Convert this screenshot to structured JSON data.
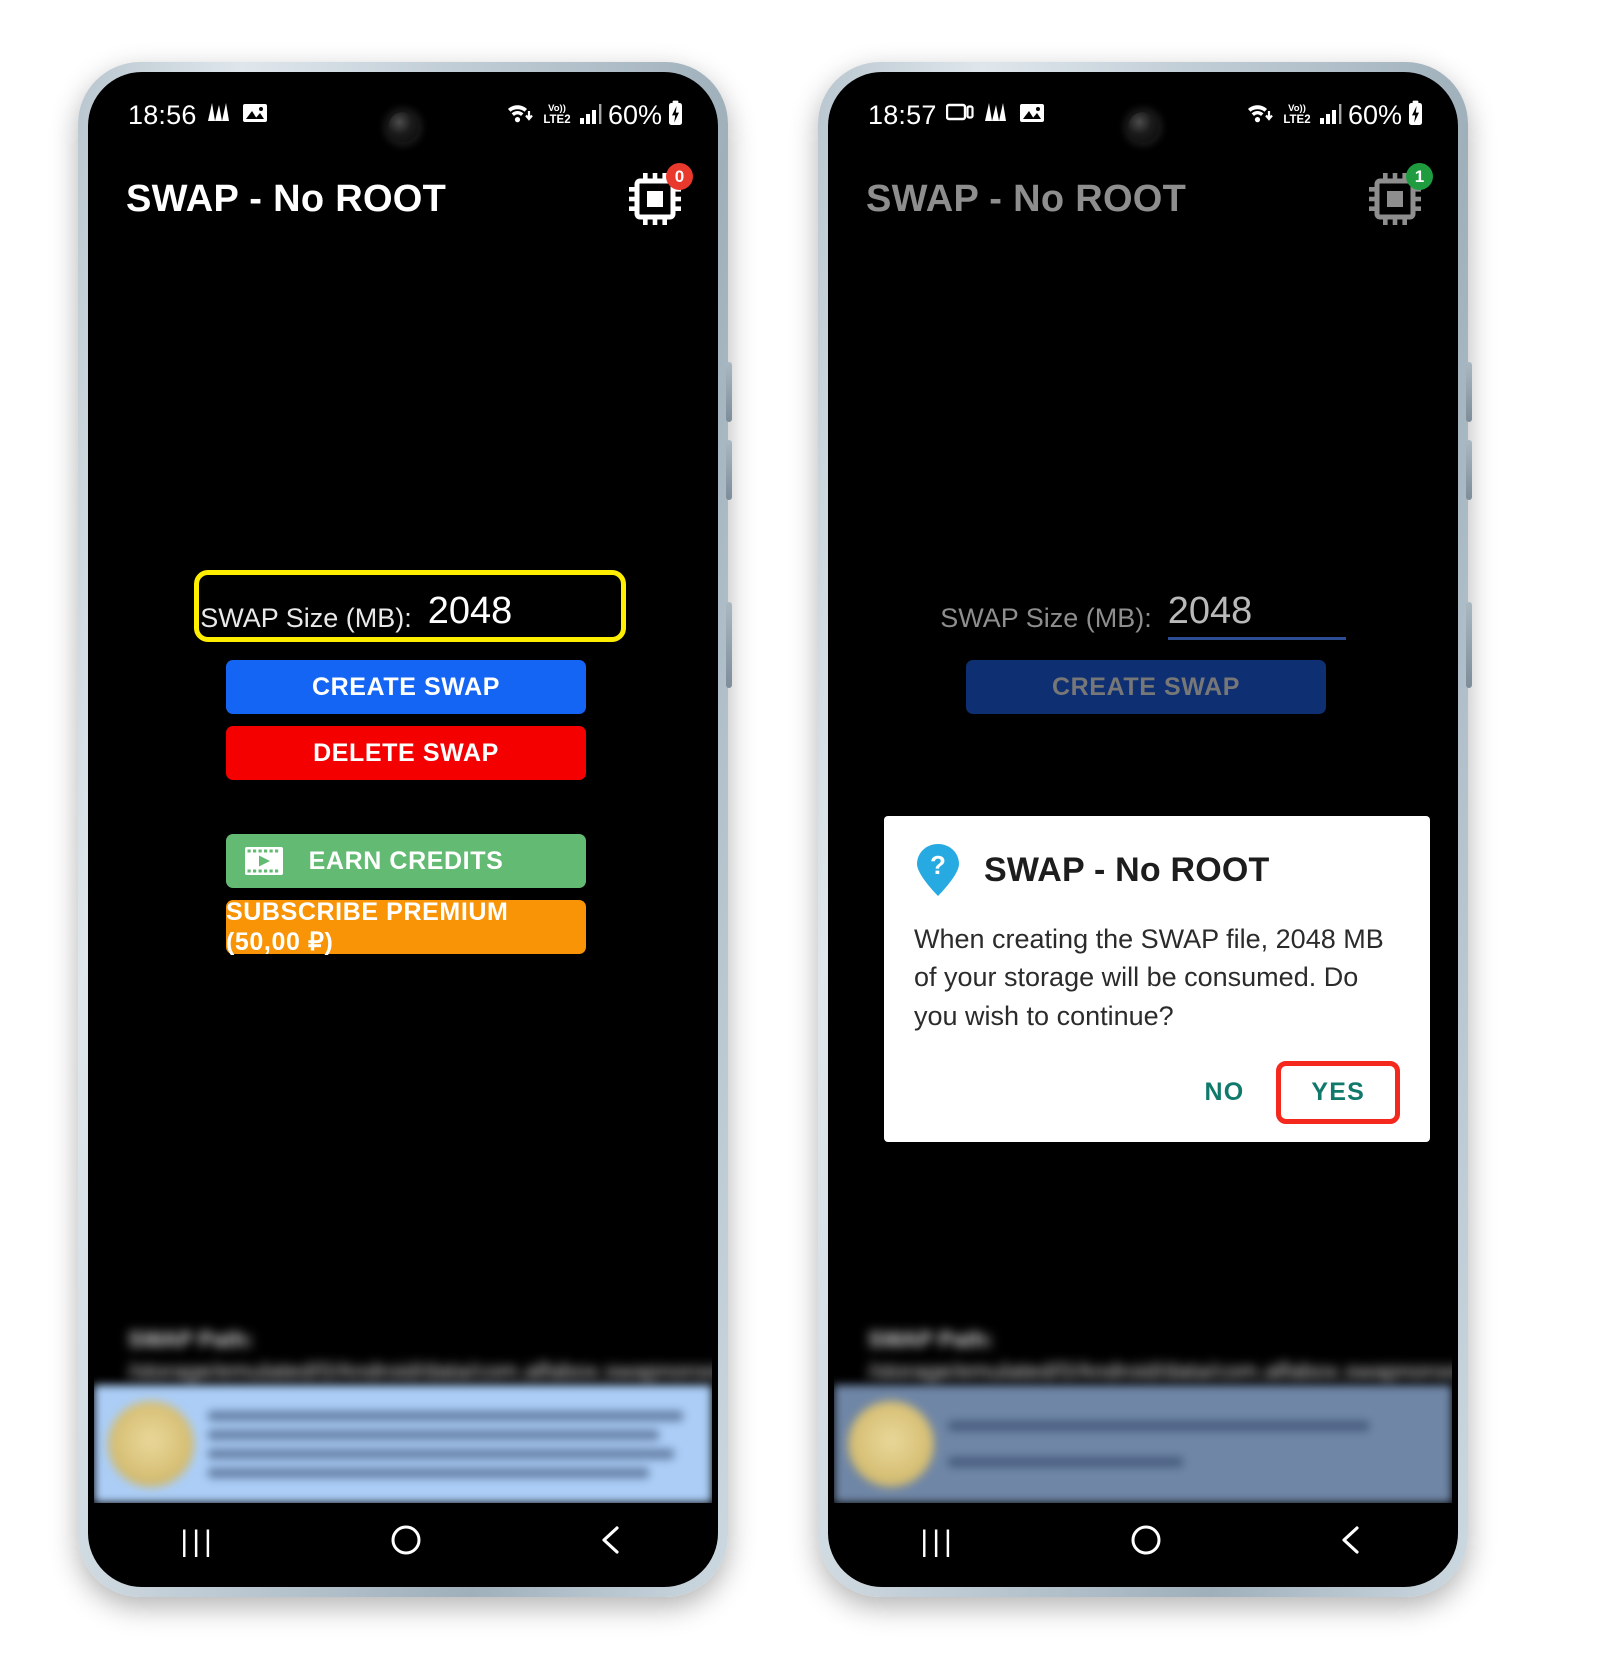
{
  "app": {
    "title": "SWAP - No ROOT",
    "cpu_icon": "cpu-chip-icon"
  },
  "colors": {
    "create": "#1565f5",
    "delete": "#f40000",
    "earn": "#63ba73",
    "premium": "#f89406",
    "highlight_yellow": "#ffee00",
    "highlight_red": "#f5281e",
    "dialog_action": "#11796b",
    "input_underline": "#3f6fd8"
  },
  "phones": [
    {
      "id": "phone-left",
      "status_bar": {
        "time": "18:56",
        "left_icons": [
          "music-waveform-icon",
          "image-icon"
        ],
        "right_icons": [
          "wifi-icon",
          "volte-lte2-icon",
          "signal-bars-icon"
        ],
        "battery": "60%",
        "battery_icon": "battery-charging-icon"
      },
      "badge": {
        "count": "0",
        "color": "#e8392c"
      },
      "form": {
        "size_label": "SWAP Size (MB):",
        "size_value": "2048"
      },
      "buttons": [
        {
          "name": "create-swap-button",
          "label": "CREATE SWAP"
        },
        {
          "name": "delete-swap-button",
          "label": "DELETE SWAP"
        },
        {
          "name": "earn-credits-button",
          "label": "EARN CREDITS",
          "icon": "video-film-icon"
        },
        {
          "name": "subscribe-premium-button",
          "label": "SUBSCRIBE PREMIUM (50,00 ₽)"
        }
      ],
      "footer": {
        "path_label": "SWAP Path:",
        "path_value": "/storage/emulated/0/Android/data/com.alfabox.swapnoroot/files/swap.swp"
      },
      "nav": {
        "recents": "|||",
        "home": "home-circle-icon",
        "back": "back-chevron-icon"
      }
    },
    {
      "id": "phone-right",
      "status_bar": {
        "time": "18:57",
        "left_icons": [
          "screen-record-icon",
          "music-waveform-icon",
          "image-icon"
        ],
        "right_icons": [
          "wifi-icon",
          "volte-lte2-icon",
          "signal-bars-icon"
        ],
        "battery": "60%",
        "battery_icon": "battery-charging-icon"
      },
      "badge": {
        "count": "1",
        "color": "#1f9c3f"
      },
      "form": {
        "size_label": "SWAP Size (MB):",
        "size_value": "2048"
      },
      "buttons": [
        {
          "name": "create-swap-button",
          "label": "CREATE SWAP"
        }
      ],
      "dialog": {
        "icon": "help-question-pin-icon",
        "title": "SWAP - No ROOT",
        "message": "When creating the SWAP file, 2048 MB of your storage will be consumed. Do you wish to continue?",
        "no_label": "NO",
        "yes_label": "YES"
      },
      "footer": {
        "path_label": "SWAP Path:",
        "path_value": "/storage/emulated/0/Android/data/com.alfabox.swapnoroot/files/swap.swp"
      },
      "nav": {
        "recents": "|||",
        "home": "home-circle-icon",
        "back": "back-chevron-icon"
      }
    }
  ]
}
